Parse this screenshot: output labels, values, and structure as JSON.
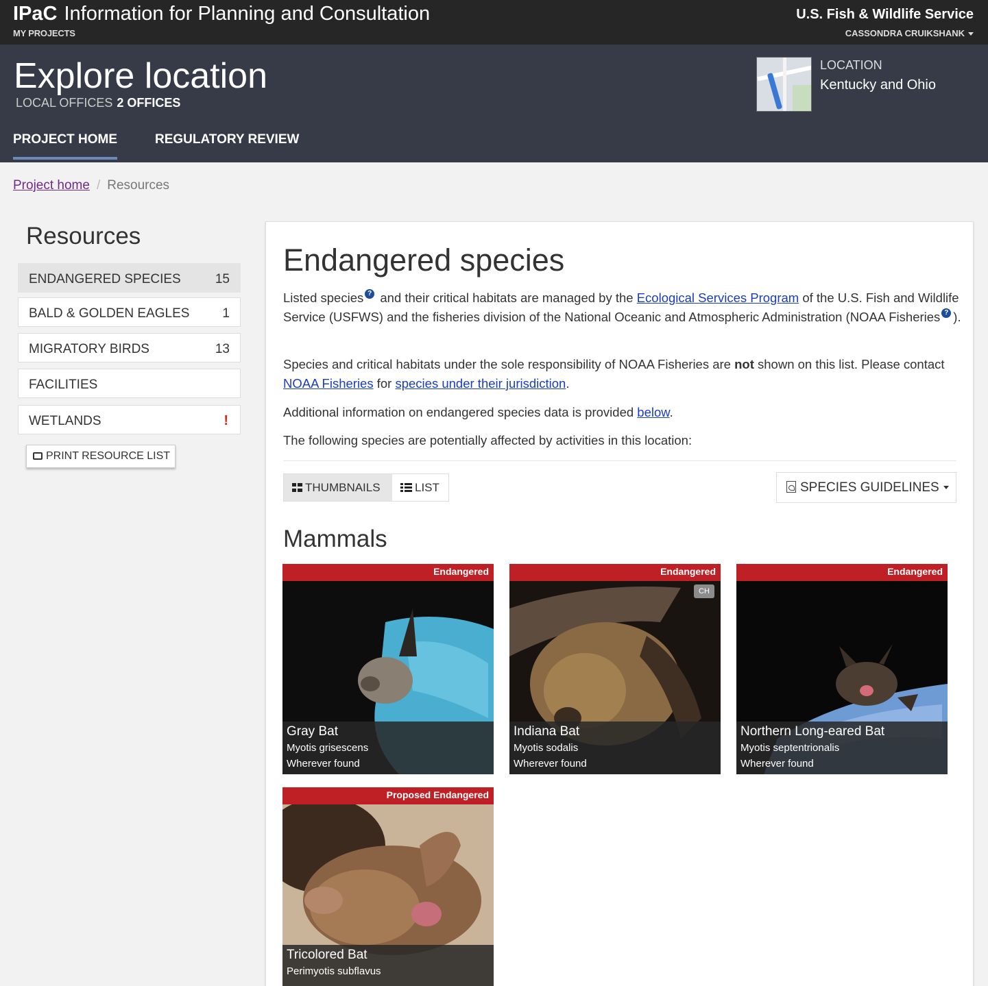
{
  "topbar": {
    "brand_short": "IPaC",
    "brand_long": "Information for Planning and Consultation",
    "my_projects": "MY PROJECTS",
    "agency": "U.S. Fish & Wildlife Service",
    "user": "CASSONDRA CRUIKSHANK"
  },
  "project": {
    "title": "Explore location",
    "local_offices_label": "LOCAL OFFICES",
    "local_offices_value": "2 OFFICES",
    "location_label": "LOCATION",
    "location_value": "Kentucky and Ohio",
    "nav": [
      "PROJECT HOME",
      "REGULATORY REVIEW"
    ]
  },
  "breadcrumb": {
    "home": "Project home",
    "separator": "/",
    "current": "Resources"
  },
  "sidebar": {
    "title": "Resources",
    "items": [
      {
        "label": "ENDANGERED SPECIES",
        "count": "15"
      },
      {
        "label": "BALD & GOLDEN EAGLES",
        "count": "1"
      },
      {
        "label": "MIGRATORY BIRDS",
        "count": "13"
      },
      {
        "label": "FACILITIES",
        "count": ""
      },
      {
        "label": "WETLANDS",
        "count": "!"
      }
    ],
    "print_label": "PRINT RESOURCE LIST"
  },
  "main": {
    "title": "Endangered species",
    "p1": {
      "a": "Listed species",
      "b": " and their critical habitats are managed by the ",
      "link1": "Ecological Services Program",
      "c": " of the U.S. Fish and Wildlife Service (USFWS) and the fisheries division of the National Oceanic and Atmospheric Administration (NOAA Fisheries",
      "d": ")."
    },
    "p2": {
      "a": "Species and critical habitats under the sole responsibility of NOAA Fisheries are ",
      "bold": "not",
      "b": " shown on this list. Please contact ",
      "link1": "NOAA Fisheries",
      "c": " for ",
      "link2": "species under their jurisdiction",
      "d": "."
    },
    "p3": {
      "a": "Additional information on endangered species data is provided ",
      "link1": "below",
      "b": "."
    },
    "p4": "The following species are potentially affected by activities in this location:",
    "view_thumbnails": "THUMBNAILS",
    "view_list": "LIST",
    "guidelines": "SPECIES GUIDELINES",
    "section": "Mammals"
  },
  "species": [
    {
      "status": "Endangered",
      "name": "Gray Bat",
      "sci": "Myotis grisescens",
      "range": "Wherever found",
      "ch": ""
    },
    {
      "status": "Endangered",
      "name": "Indiana Bat",
      "sci": "Myotis sodalis",
      "range": "Wherever found",
      "ch": "CH"
    },
    {
      "status": "Endangered",
      "name": "Northern Long-eared Bat",
      "sci": "Myotis septentrionalis",
      "range": "Wherever found",
      "ch": ""
    },
    {
      "status": "Proposed Endangered",
      "name": "Tricolored Bat",
      "sci": "Perimyotis subflavus",
      "range": "",
      "ch": ""
    }
  ],
  "colors": {
    "topbar": "#262626",
    "header": "#363b47",
    "status_red": "#bf2026",
    "link": "#1a3dbd"
  }
}
